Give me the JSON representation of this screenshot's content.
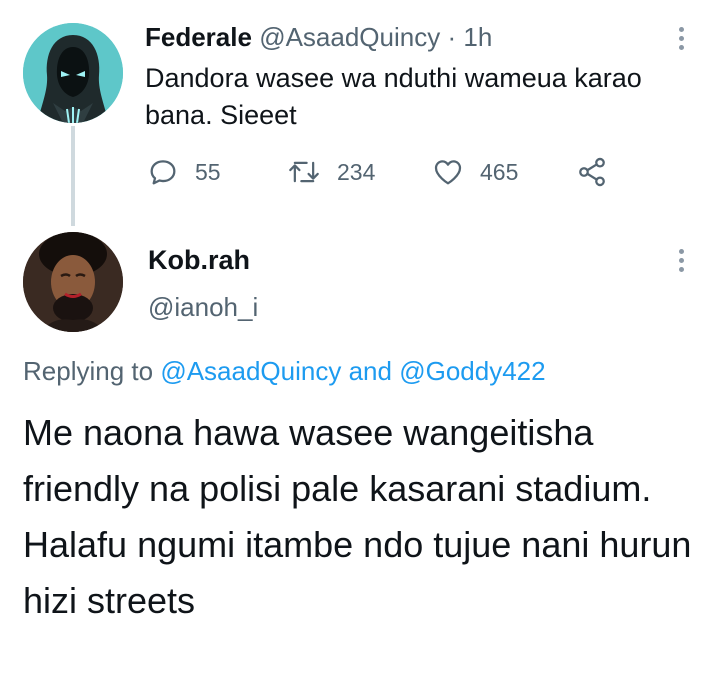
{
  "parent_tweet": {
    "author_name": "Federale",
    "author_handle": "@AsaadQuincy",
    "separator": "·",
    "time": "1h",
    "text": "Dandora wasee wa nduthi wameua karao bana. Sieeet",
    "replies": "55",
    "retweets": "234",
    "likes": "465",
    "avatar_icon": "hooded-figure-avatar",
    "more_icon": "more-vertical-icon"
  },
  "reply_tweet": {
    "author_name": "Kob.rah",
    "author_handle": "@ianoh_i",
    "replying_prefix": "Replying to",
    "replying_mention_1": "@AsaadQuincy",
    "replying_and": "and",
    "replying_mention_2": "@Goddy422",
    "text": "Me naona hawa wasee wangeitisha friendly na polisi pale kasarani stadium. Halafu ngumi itambe ndo tujue nani hurun hizi streets",
    "avatar_icon": "profile-photo-avatar",
    "more_icon": "more-vertical-icon"
  },
  "colors": {
    "text_primary": "#0f1419",
    "text_secondary": "#536471",
    "link": "#1d9bf0",
    "thread_line": "#cfd9de",
    "avatar1_bg": "#5ec7c9"
  }
}
